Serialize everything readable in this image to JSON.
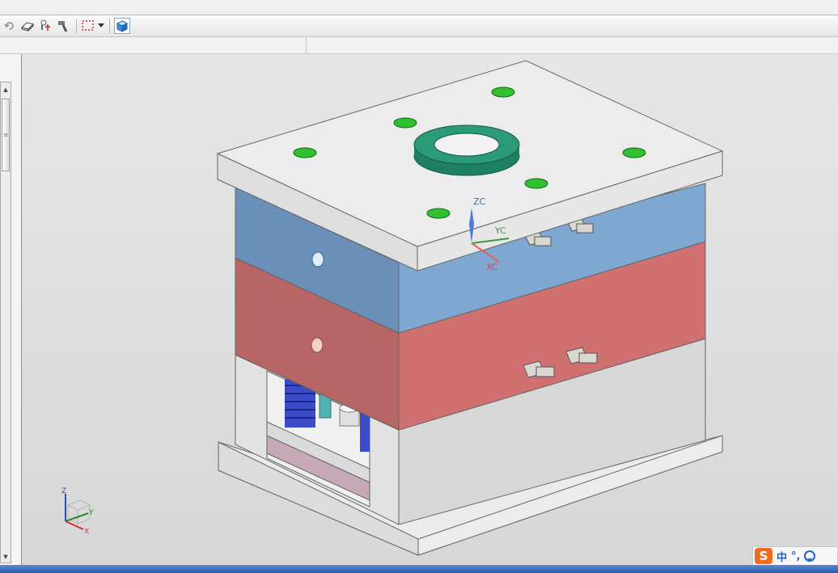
{
  "toolbar": {
    "icons": [
      "undo-icon",
      "eraser-icon",
      "snap-point-icon",
      "hammer-icon",
      "selection-box-icon",
      "dropdown-arrow-icon",
      "view-cube-icon"
    ]
  },
  "viewport": {
    "wcs_labels": {
      "z": "ZC",
      "y": "YC",
      "x": "XC"
    },
    "triad_labels": {
      "z": "Z",
      "y": "Y",
      "x": "X"
    },
    "colors": {
      "top_clamp_plate": "#ececec",
      "a_plate": "#7ea8d2",
      "b_plate": "#d07070",
      "spacer_block": "#dcdcdc",
      "locating_ring": "#2a9a78",
      "bolt_holes": "#30c030",
      "ejector_springs": "#3c4bc8"
    }
  },
  "ime": {
    "logo": "S",
    "mode": "中",
    "punct": "°,",
    "smiley": "smiley-icon"
  }
}
